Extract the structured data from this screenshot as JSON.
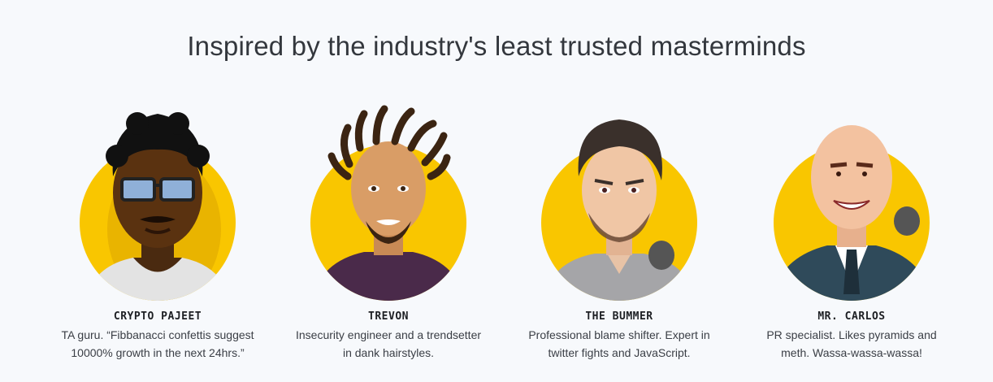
{
  "headline": "Inspired by the industry's least trusted masterminds",
  "colors": {
    "circle_yellow": "#f9c600",
    "background": "#f7f9fc"
  },
  "team": [
    {
      "name": "CRYPTO PAJEET",
      "bio_line1": "TA guru. “Fibbanacci confettis suggest",
      "bio_line2": "10000% growth in the next 24hrs.”",
      "icon": "crypto-pajeet-avatar"
    },
    {
      "name": "TREVON",
      "bio_line1": "Insecurity engineer and a trendsetter",
      "bio_line2": "in dank hairstyles.",
      "icon": "trevon-avatar"
    },
    {
      "name": "THE BUMMER",
      "bio_line1": "Professional blame shifter. Expert in",
      "bio_line2": "twitter fights and JavaScript.",
      "icon": "the-bummer-avatar"
    },
    {
      "name": "MR. CARLOS",
      "bio_line1": "PR specialist. Likes pyramids and",
      "bio_line2": "meth. Wassa-wassa-wassa!",
      "icon": "mr-carlos-avatar"
    }
  ]
}
